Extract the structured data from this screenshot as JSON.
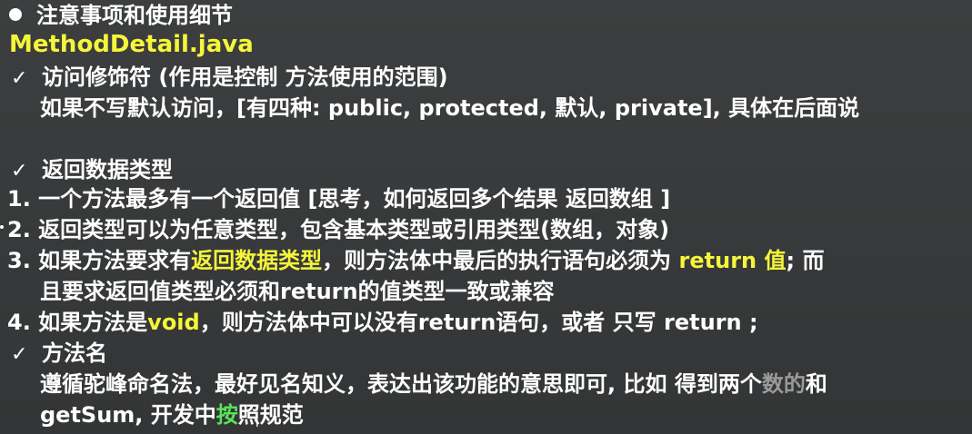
{
  "heading": "注意事项和使用细节",
  "filename": "MethodDetail.java",
  "sections": {
    "access": {
      "title": "访问修饰符 (作用是控制 方法使用的范围)",
      "detail": "如果不写默认访问，[有四种: public, protected, 默认, private], 具体在后面说"
    },
    "return_type": {
      "title": "返回数据类型",
      "item1": "1. 一个方法最多有一个返回值  [思考，如何返回多个结果 返回数组 ]",
      "item2": "2. 返回类型可以为任意类型，包含基本类型或引用类型(数组，对象)",
      "item3_a": "3. 如果方法要求有",
      "item3_b": "返回数据类型",
      "item3_c": "，则方法体中最后的执行语句必须为 ",
      "item3_d": "return 值",
      "item3_e": "; 而",
      "item3_cont": "且要求返回值类型必须和return的值类型一致或兼容",
      "item4_a": "4. 如果方法是",
      "item4_b": "void",
      "item4_c": "，则方法体中可以没有return语句，或者 只写 return ;"
    },
    "method_name": {
      "title": "方法名",
      "detail_a": "遵循驼峰命名法，最好见名知义，表达出该功能的意思即可, 比如 得到两个",
      "detail_b": "数的",
      "detail_c": "和",
      "line2_a": "getSum, 开发中",
      "line2_b": "按",
      "line2_c": "照规范"
    }
  },
  "check_glyph": "✓",
  "colors": {
    "background": "#383a3b",
    "text": "#ffffff",
    "highlight": "#f5f53a",
    "faded": "#9a9a9a",
    "cursor_green": "#58e35a"
  }
}
